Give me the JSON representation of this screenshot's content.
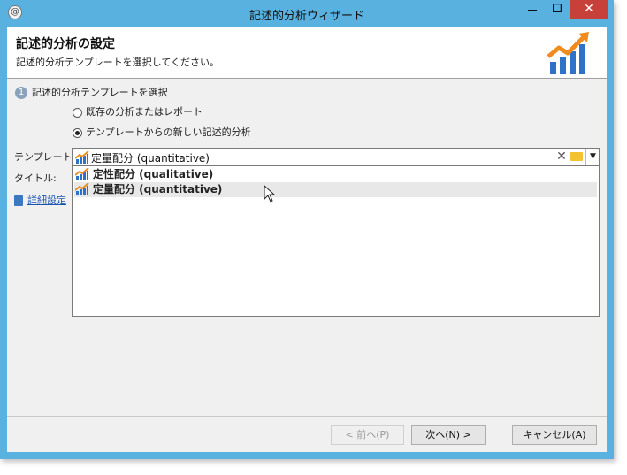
{
  "window": {
    "title": "記述的分析ウィザード",
    "app_icon": "@"
  },
  "header": {
    "title": "記述的分析の設定",
    "subtitle": "記述的分析テンプレートを選択してください。"
  },
  "step": {
    "number": "1",
    "label": "記述的分析テンプレートを選択"
  },
  "options": {
    "existing": "既存の分析またはレポート",
    "new_from_template": "テンプレートからの新しい記述的分析",
    "selected": "new_from_template"
  },
  "form": {
    "template_label": "テンプレート:",
    "template_value": "定量配分 (quantitative)",
    "title_label": "タイトル:",
    "advanced_link": "詳細設定"
  },
  "dropdown": {
    "items": [
      "定性配分 (qualitative)",
      "定量配分 (quantitative)"
    ],
    "hover_index": 1
  },
  "buttons": {
    "prev": "< 前へ(P)",
    "next": "次へ(N) >",
    "cancel": "キャンセル(A)"
  },
  "colors": {
    "frame": "#58b1df",
    "close": "#c7413a",
    "chart_orange": "#f08c1e",
    "chart_blue": "#2f73c9"
  },
  "icons": [
    "app-icon",
    "minimize-icon",
    "maximize-icon",
    "close-icon",
    "analysis-chart-icon",
    "clear-icon",
    "folder-icon",
    "dropdown-arrow-icon",
    "advanced-settings-icon",
    "mouse-cursor-icon"
  ]
}
